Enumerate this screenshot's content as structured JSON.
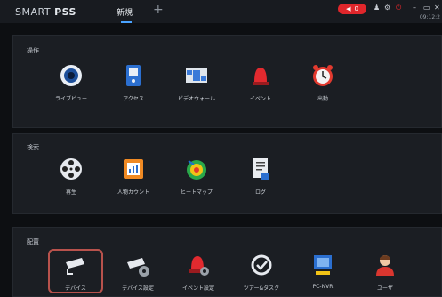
{
  "app": {
    "brand_light": "SMART ",
    "brand_bold": "PSS",
    "tab_label": "新規",
    "add_tab": "+"
  },
  "status": {
    "alarm_count": "0",
    "clock": "09:12:2"
  },
  "sections": [
    {
      "title": "操作",
      "items": [
        {
          "label": "ライブビュー",
          "icon": "live-view-icon"
        },
        {
          "label": "アクセス",
          "icon": "access-icon"
        },
        {
          "label": "ビデオウォール",
          "icon": "video-wall-icon"
        },
        {
          "label": "イベント",
          "icon": "event-icon"
        },
        {
          "label": "出勤",
          "icon": "attendance-icon"
        }
      ]
    },
    {
      "title": "検索",
      "items": [
        {
          "label": "再生",
          "icon": "playback-icon"
        },
        {
          "label": "人物カウント",
          "icon": "people-count-icon"
        },
        {
          "label": "ヒートマップ",
          "icon": "heatmap-icon"
        },
        {
          "label": "ログ",
          "icon": "log-icon"
        }
      ]
    },
    {
      "title": "配置",
      "items": [
        {
          "label": "デバイス",
          "icon": "device-icon"
        },
        {
          "label": "デバイス設定",
          "icon": "device-config-icon"
        },
        {
          "label": "イベント設定",
          "icon": "event-config-icon"
        },
        {
          "label": "ツアー&タスク",
          "icon": "tour-task-icon"
        },
        {
          "label": "PC-NVR",
          "icon": "pc-nvr-icon"
        },
        {
          "label": "ユーザ",
          "icon": "user-icon"
        }
      ]
    }
  ]
}
